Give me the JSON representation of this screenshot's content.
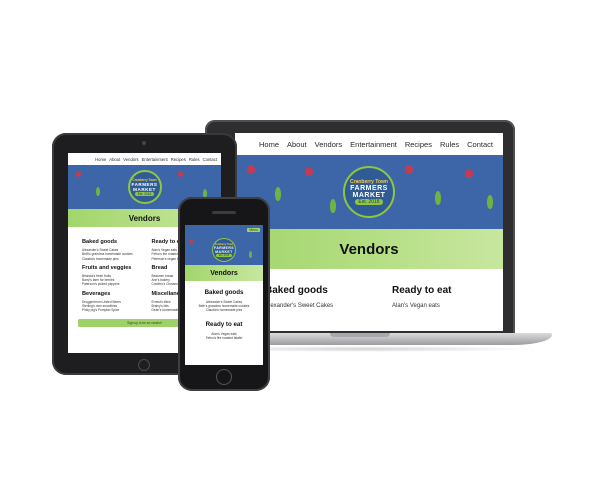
{
  "nav": [
    "Home",
    "About",
    "Vendors",
    "Entertainment",
    "Recipes",
    "Rules",
    "Contact"
  ],
  "logo": {
    "line1": "Cranberry Town",
    "line2": "FARMERS",
    "line3": "MARKET",
    "line4": "Est. 2018"
  },
  "page_title": "Vendors",
  "phone_menu_label": "Menu",
  "sections": {
    "baked": {
      "heading": "Baked goods",
      "items": [
        "Alexander's Sweet Cakes",
        "Beth's grandma homemade cookies",
        "Claudia's homemade pies"
      ]
    },
    "ready": {
      "heading": "Ready to eat",
      "items": [
        "Alan's Vegan eats",
        "Fefno's fire roasted falafel",
        "Peterson's vegan bites"
      ]
    },
    "fruits": {
      "heading": "Fruits and veggies",
      "items": [
        "Brianda's fresh fruits",
        "Barry's farm for berries",
        "Paterson's picked peppers"
      ]
    },
    "bread": {
      "heading": "Bread",
      "items": [
        "Beasmer bread",
        "Ann's bakery",
        "Cordero's Cinnamon rolls"
      ]
    },
    "beverages": {
      "heading": "Beverages",
      "items": [
        "Droggenbrum United Beers",
        "Sterling's own smoothies",
        "Pinky pig's Pumpkin Spice"
      ]
    },
    "misc": {
      "heading": "Miscellaneous",
      "items": [
        "Ernest's bites",
        "Brainy's bits",
        "Dean's homemade pies"
      ]
    }
  },
  "cta_label": "Sign up to be an vendor!",
  "colors": {
    "hero_blue": "#3d66a8",
    "band_green": "#a2d56c",
    "accent_gold": "#f7c948"
  }
}
